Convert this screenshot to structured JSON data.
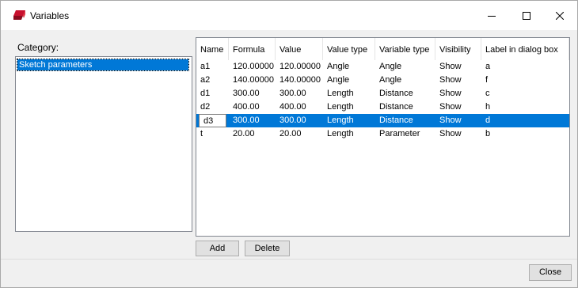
{
  "window": {
    "title": "Variables",
    "app_icon": "shapr-app-icon",
    "controls": {
      "minimize": "minimize-icon",
      "maximize": "maximize-icon",
      "close": "close-icon"
    }
  },
  "category": {
    "label": "Category:",
    "items": [
      "Sketch parameters"
    ],
    "selected": "Sketch parameters"
  },
  "table": {
    "columns": [
      "Name",
      "Formula",
      "Value",
      "Value type",
      "Variable type",
      "Visibility",
      "Label in dialog box"
    ],
    "rows": [
      [
        "a1",
        "120.00000",
        "120.00000",
        "Angle",
        "Angle",
        "Show",
        "a"
      ],
      [
        "a2",
        "140.00000",
        "140.00000",
        "Angle",
        "Angle",
        "Show",
        "f"
      ],
      [
        "d1",
        "300.00",
        "300.00",
        "Length",
        "Distance",
        "Show",
        "c"
      ],
      [
        "d2",
        "400.00",
        "400.00",
        "Length",
        "Distance",
        "Show",
        "h"
      ],
      [
        "d3",
        "300.00",
        "300.00",
        "Length",
        "Distance",
        "Show",
        "d"
      ],
      [
        "t",
        "20.00",
        "20.00",
        "Length",
        "Parameter",
        "Show",
        "b"
      ]
    ],
    "selected_row_index": 4
  },
  "buttons": {
    "add": "Add",
    "delete": "Delete",
    "close": "Close"
  },
  "colors": {
    "selection": "#0078d7",
    "window_bg": "#f0f0f0",
    "app_icon": "#c8102e"
  }
}
